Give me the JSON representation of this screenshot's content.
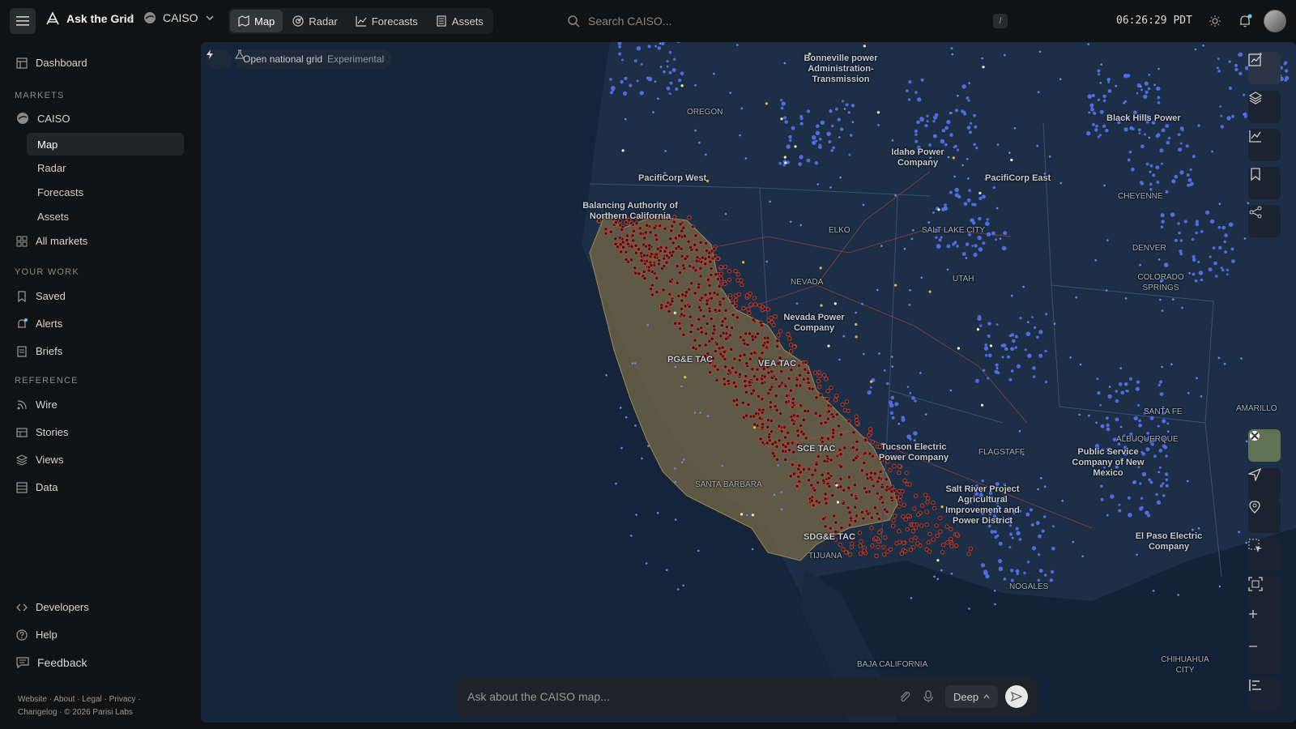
{
  "app": {
    "brand": "Ask the Grid",
    "market": "CAISO"
  },
  "nav": {
    "tabs": [
      "Map",
      "Radar",
      "Forecasts",
      "Assets"
    ],
    "active": "Map"
  },
  "search": {
    "placeholder": "Search CAISO...",
    "shortcut": "/"
  },
  "clock": "06:26:29 PDT",
  "sidebar": {
    "dashboard": "Dashboard",
    "markets_heading": "MARKETS",
    "market": "CAISO",
    "market_items": [
      "Map",
      "Radar",
      "Forecasts",
      "Assets"
    ],
    "all_markets": "All markets",
    "work_heading": "YOUR WORK",
    "work_items": [
      "Saved",
      "Alerts",
      "Briefs"
    ],
    "reference_heading": "REFERENCE",
    "reference_items": [
      "Wire",
      "Stories",
      "Views",
      "Data"
    ],
    "developers": "Developers",
    "help": "Help",
    "feedback": "Feedback",
    "footer_line1": "Website · About · Legal · Privacy ·",
    "footer_line2": "Changelog · © 2026 Parisi Labs"
  },
  "map": {
    "chip_label": "Open national grid",
    "chip_tag": "Experimental",
    "labels": {
      "bonneville": "Bonneville power Administration-Transmission",
      "oregon": "OREGON",
      "idaho_power": "Idaho Power Company",
      "pacificorp_west": "PacifiCorp West",
      "pacificorp_east": "PacifiCorp East",
      "balancing": "Balancing Authority of Northern California",
      "nevada": "NEVADA",
      "elko": "ELKO",
      "utah": "UTAH",
      "nevada_power": "Nevada Power Company",
      "vea_tac": "VEA TAC",
      "sce_tac": "SCE TAC",
      "tucson": "Tucson Electric Power Company",
      "salt_river": "Salt River Project Agricultural Improvement and Power District",
      "public_service": "Public Service Company of New Mexico",
      "el_paso": "El Paso Electric Company",
      "denver": "DENVER",
      "colorado_springs": "COLORADO SPRINGS",
      "cheyenne": "CHEYENNE",
      "black_hills": "Black Hills Power",
      "santa_barbara": "SANTA BARBARA",
      "tijuana": "TIJUANA",
      "nogales": "NOGALES",
      "baja": "BAJA CALIFORNIA",
      "chihuahua": "CHIHUAHUA CITY",
      "amarillo": "AMARILLO",
      "flagstaff": "FLAGSTAFF",
      "santa_fe": "SANTA FE",
      "albuquerque": "ALBUQUERQUE",
      "salt_lake": "SALT LAKE CITY",
      "sdge_tac": "SDG&E TAC",
      "pge_tac": "PG&E TAC"
    }
  },
  "ask": {
    "placeholder": "Ask about the CAISO map...",
    "mode": "Deep"
  },
  "colors": {
    "bg": "#111213",
    "map_water": "#13243b",
    "land": "#1c2f47",
    "caiso": "#6b6147",
    "plant_red": "#c0463a",
    "plant_blue": "#4f6de0"
  }
}
